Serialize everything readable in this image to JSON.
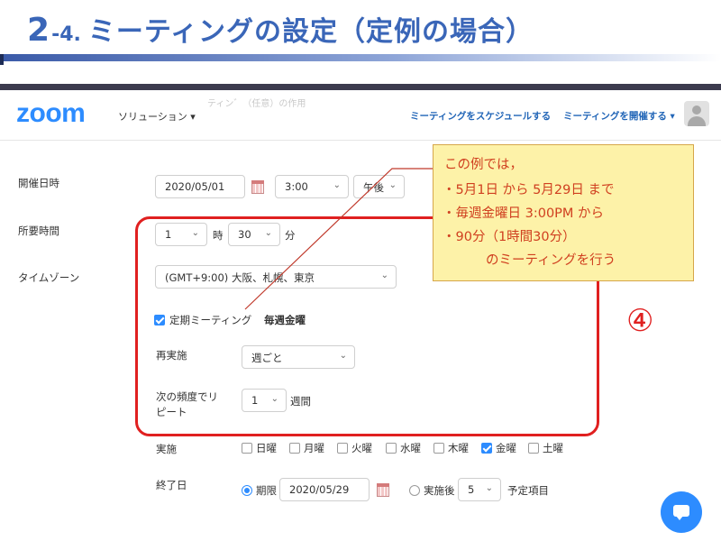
{
  "slide": {
    "title_num": "2",
    "title_sub": "-4.",
    "title_text": "ミーティングの設定（定例の場合）"
  },
  "nav": {
    "logo": "zoom",
    "solutions": "ソリューション ▾",
    "schedule_link": "ミーティングをスケジュールする",
    "host_link": "ミーティングを開催する ▾",
    "ghost_text": "ティン゛（任意）の作用"
  },
  "form": {
    "date_label": "開催日時",
    "date_value": "2020/05/01",
    "time_value": "3:00",
    "ampm_value": "午後",
    "duration_label": "所要時間",
    "hours_value": "1",
    "hours_unit": "時",
    "minutes_value": "30",
    "minutes_unit": "分",
    "timezone_label": "タイムゾーン",
    "timezone_value": "(GMT+9:00) 大阪、札幌、東京"
  },
  "recurring": {
    "checkbox_label": "定期ミーティング",
    "summary": "毎週金曜",
    "repeat_label": "再実施",
    "repeat_value": "週ごと",
    "freq_label_1": "次の頻度でリ",
    "freq_label_2": "ピート",
    "freq_value": "1",
    "freq_unit": "週間",
    "days_label": "実施",
    "days": [
      {
        "label": "日曜",
        "checked": false
      },
      {
        "label": "月曜",
        "checked": false
      },
      {
        "label": "火曜",
        "checked": false
      },
      {
        "label": "水曜",
        "checked": false
      },
      {
        "label": "木曜",
        "checked": false
      },
      {
        "label": "金曜",
        "checked": true
      },
      {
        "label": "土曜",
        "checked": false
      }
    ],
    "end_label": "終了日",
    "end_by_label": "期限",
    "end_date_value": "2020/05/29",
    "after_label": "実施後",
    "after_value": "5",
    "after_unit": "予定項目"
  },
  "callout": {
    "line1": "この例では，",
    "line2": "・5月1日 から 5月29日 まで",
    "line3": "・毎週金曜日 3:00PM から",
    "line4": "・90分（1時間30分）",
    "line5": "のミーティングを行う"
  },
  "marker": "④",
  "colors": {
    "brand": "#2d8cff",
    "title": "#3a66b8",
    "highlight_red": "#e02020",
    "callout_bg": "#fdf2a8",
    "callout_text": "#d04020"
  }
}
